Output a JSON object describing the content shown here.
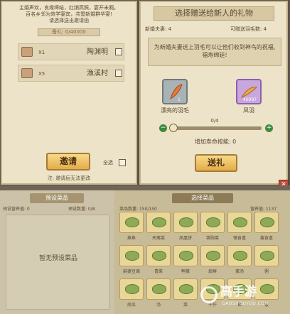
{
  "left_panel": {
    "intro": [
      "主婚声欢，良缘缔结，红绡高照，宴开未厢。",
      "百名乡邻为效学宴宾，共誓新婚群华宴!",
      "请选择送出邀请函"
    ],
    "invite_count": "备礼: 0/40000",
    "guests": [
      {
        "count": "X1",
        "name": "陶渊明"
      },
      {
        "count": "X5",
        "name": "渔溪村"
      }
    ],
    "invite_label": "邀请",
    "select_all_label": "全选",
    "footnote": "注: 邀请后无法更改"
  },
  "right_panel": {
    "title": "选择赠送给新人的礼物",
    "couple_label": "新婚夫妻: 4",
    "feather_label": "可赠送羽毛数: 4",
    "description": "为新婚夫妻送上羽毛可以让他们收到神鸟的祝福,福寿绵延!",
    "gifts": [
      {
        "name": "漂亮的羽毛",
        "count": "1"
      },
      {
        "name": "凤羽",
        "count": "40097"
      }
    ],
    "slider_minus": "−",
    "slider_plus": "+",
    "slider_value": "0/4",
    "slider_fraction": 0,
    "bonus_label": "增加寿命按能: 0",
    "send_label": "送礼",
    "close_glyph": "✕"
  },
  "bottom_left": {
    "tab": "预设菜品",
    "preset_info": "预设营养值: 0",
    "preset_count": "预设数量: 0/8",
    "empty_text": "暂无预设菜品"
  },
  "bottom_right": {
    "tab": "选择菜品",
    "dish_count": "菜品数量: 150/150",
    "nutrition": "营养值: 1137",
    "dish_rows": [
      [
        "蒸鱼",
        "天寓菜",
        "凤凰饼",
        "锦驹菜",
        "镜食盒",
        "酱食盒"
      ],
      [
        "麻婆豆腐",
        "青菜",
        "鸭蛋",
        "烩鲜",
        "蛋汤",
        "粥"
      ],
      [
        "南瓜",
        "汤",
        "菜",
        "千仟",
        "鱼",
        "饭"
      ]
    ]
  },
  "watermark": {
    "brand": "高手游",
    "site": "GAOSHOUYOU.COM"
  }
}
